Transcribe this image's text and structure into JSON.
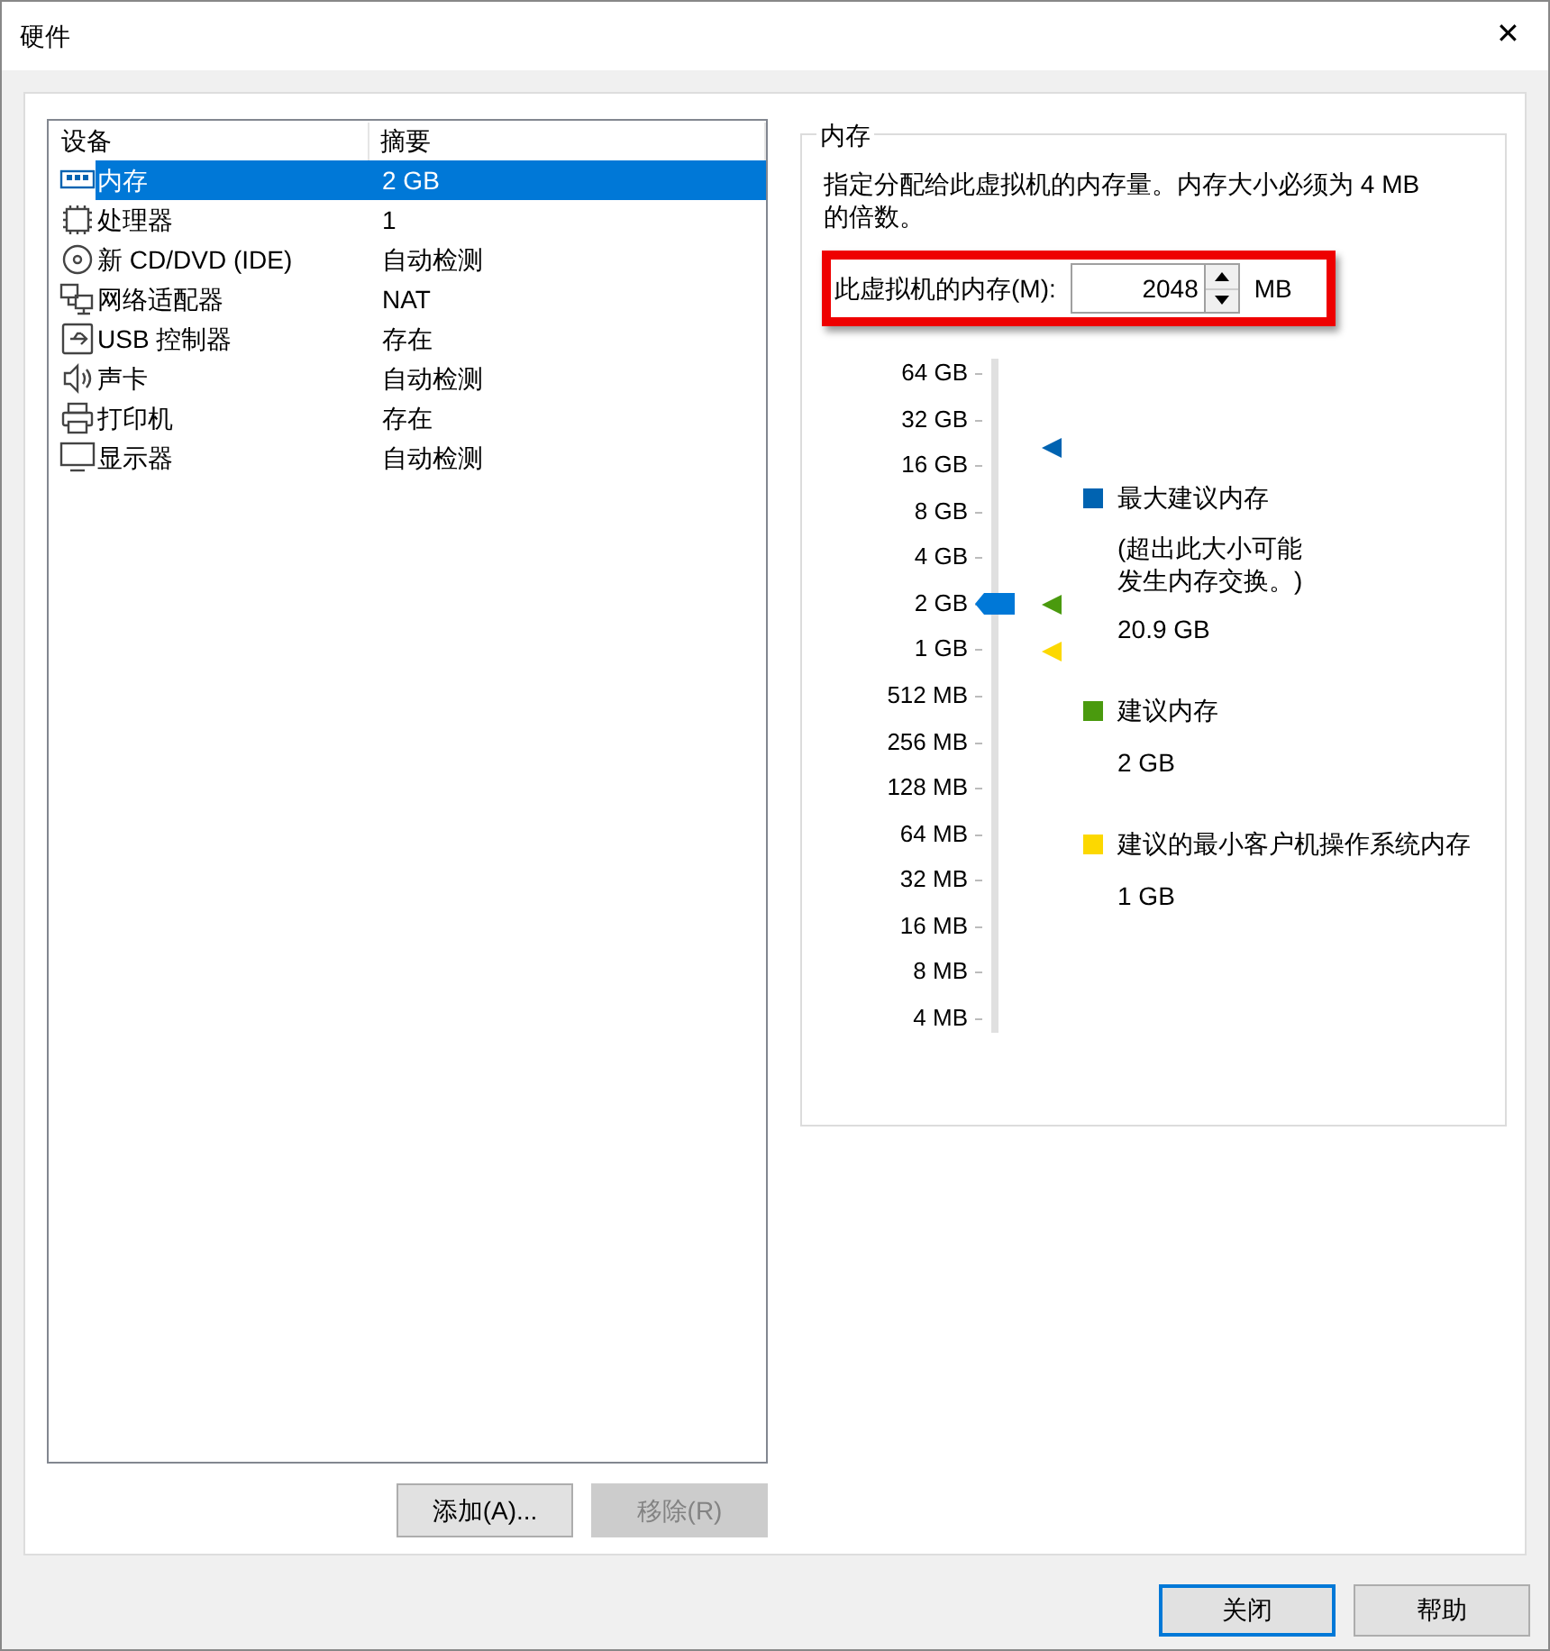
{
  "window": {
    "title": "硬件",
    "close": "✕"
  },
  "devices": {
    "columns": [
      "设备",
      "摘要"
    ],
    "rows": [
      {
        "name": "内存",
        "summary": "2 GB",
        "selected": true
      },
      {
        "name": "处理器",
        "summary": "1",
        "selected": false
      },
      {
        "name": "新 CD/DVD (IDE)",
        "summary": "自动检测",
        "selected": false
      },
      {
        "name": "网络适配器",
        "summary": "NAT",
        "selected": false
      },
      {
        "name": "USB 控制器",
        "summary": "存在",
        "selected": false
      },
      {
        "name": "声卡",
        "summary": "自动检测",
        "selected": false
      },
      {
        "name": "打印机",
        "summary": "存在",
        "selected": false
      },
      {
        "name": "显示器",
        "summary": "自动检测",
        "selected": false
      }
    ]
  },
  "list_buttons": [
    {
      "label": "添加(A)...",
      "disabled": false
    },
    {
      "label": "移除(R)",
      "disabled": true
    }
  ],
  "memory": {
    "title": "内存",
    "description": "指定分配给此虚拟机的内存量。内存大小必须为 4 MB 的倍数。",
    "field_label": "此虚拟机的内存(M):",
    "value": "2048",
    "unit": "MB",
    "slider": {
      "level": 0.643,
      "ticks": [
        "64 GB",
        "32 GB",
        "16 GB",
        "8 GB",
        "4 GB",
        "2 GB",
        "1 GB",
        "512 MB",
        "256 MB",
        "128 MB",
        "64 MB",
        "32 MB",
        "16 MB",
        "8 MB",
        "4 MB"
      ]
    },
    "legend": [
      {
        "label": "最大建议内存",
        "note": "(超出此大小可能发生内存交换。)",
        "value": "20.9 GB",
        "color": "#0063b1"
      },
      {
        "label": "建议内存",
        "value": "2 GB",
        "color": "#4a9a0e"
      },
      {
        "label": "建议的最小客户机操作系统内存",
        "value": "1 GB",
        "color": "#fcd800"
      }
    ]
  },
  "footer_buttons": [
    {
      "label": "关闭",
      "default": true
    },
    {
      "label": "帮助",
      "default": false
    }
  ]
}
